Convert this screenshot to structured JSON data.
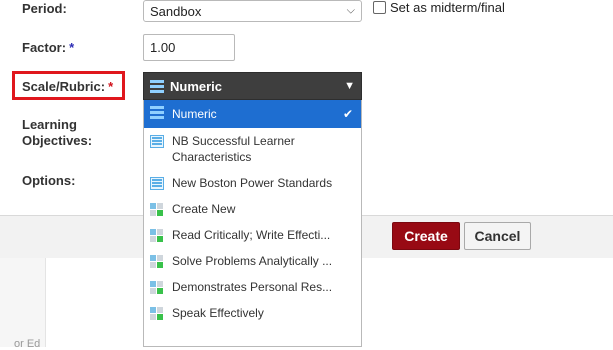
{
  "form": {
    "period_label": "Period:",
    "period_value": "Sandbox",
    "midterm_label": "Set as midterm/final",
    "factor_label": "Factor:",
    "factor_required": "*",
    "factor_value": "1.00",
    "scale_label": "Scale/Rubric:",
    "scale_required": "*",
    "scale_value": "Numeric",
    "learning_objectives_label": "Learning Objectives:",
    "options_label": "Options:"
  },
  "dropdown": {
    "items": [
      {
        "label": "Numeric",
        "icon": "numeric-scale-icon",
        "selected": true
      },
      {
        "label": "NB Successful Learner Characteristics",
        "icon": "list-scale-icon"
      },
      {
        "label": "New Boston Power Standards",
        "icon": "list-scale-icon"
      },
      {
        "label": "Create New",
        "icon": "rubric-grid-icon"
      },
      {
        "label": "Read Critically; Write Effecti...",
        "icon": "rubric-grid-icon"
      },
      {
        "label": "Solve Problems Analytically ...",
        "icon": "rubric-grid-icon"
      },
      {
        "label": "Demonstrates Personal Res...",
        "icon": "rubric-grid-icon"
      },
      {
        "label": "Speak Effectively",
        "icon": "rubric-grid-icon"
      }
    ]
  },
  "buttons": {
    "create": "Create",
    "cancel": "Cancel"
  },
  "left_strip_text": "or Ed",
  "colors": {
    "highlight": "#e0171d",
    "selected": "#1e6ed1",
    "create_button": "#980a14"
  }
}
